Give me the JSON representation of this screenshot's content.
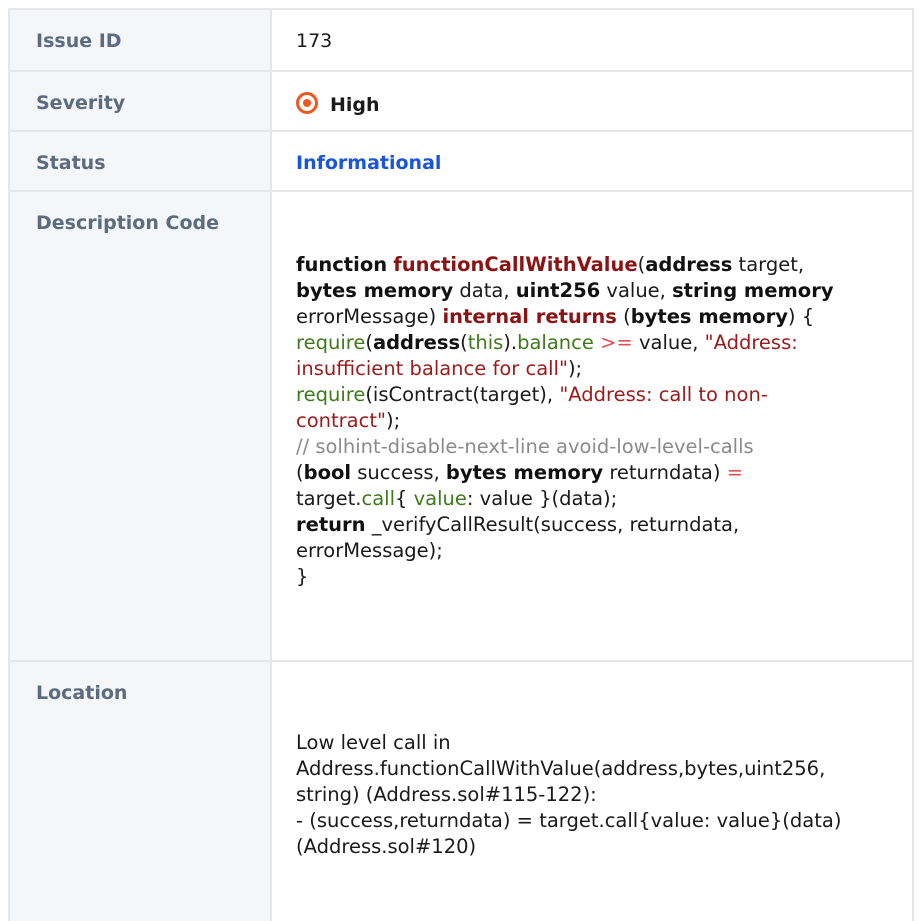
{
  "rows": {
    "issue_id": {
      "label": "Issue ID",
      "value": "173"
    },
    "severity": {
      "label": "Severity",
      "value": "High",
      "icon": "target-icon",
      "color": "#f0581e"
    },
    "status": {
      "label": "Status",
      "value": "Informational",
      "color": "#1a56db"
    },
    "description": {
      "label": "Description Code"
    },
    "location": {
      "label": "Location"
    }
  },
  "code": {
    "l1_kw_function": "function",
    "l1_fn_name": "functionCallWithValue",
    "l1_paren": "(",
    "l1_kw_address": "address",
    "l1_target": " target,",
    "l2_kw_bytes_memory": "bytes memory",
    "l2_data": " data, ",
    "l2_kw_uint256": "uint256",
    "l2_value": " value, ",
    "l2_kw_string_memory": "string memory",
    "l3_errormsg": "errorMessage) ",
    "l3_internal_returns": "internal returns",
    "l3_open": " (",
    "l3_kw_bytes_memory": "bytes memory",
    "l3_close": ") {",
    "l4_require": "require",
    "l4_paren": "(",
    "l4_kw_address": "address",
    "l4_paren2": "(",
    "l4_this": "this",
    "l4_dot": ").",
    "l4_balance": "balance",
    "l4_sp": " ",
    "l4_gte": ">=",
    "l4_value": " value, ",
    "l4_str1": "\"Address:",
    "l5_str2": "insufficient balance for call\"",
    "l5_end": ");",
    "l6_require": "require",
    "l6_mid": "(isContract(target), ",
    "l6_str1": "\"Address: call to non-",
    "l7_str2": "contract\"",
    "l7_end": ");",
    "l8_comment": "// solhint-disable-next-line avoid-low-level-calls",
    "l9_open": "(",
    "l9_kw_bool": "bool",
    "l9_success": " success, ",
    "l9_kw_bytes_memory": "bytes memory",
    "l9_returndata": " returndata) ",
    "l9_eq": "=",
    "l10_target": "target.",
    "l10_call": "call",
    "l10_brace": "{ ",
    "l10_value_kw": "value",
    "l10_rest": ": value }(data);",
    "l11_kw_return": "return",
    "l11_rest": " _verifyCallResult(success, returndata,",
    "l12": "errorMessage);",
    "l13": "}"
  },
  "location_text": {
    "l1": "Low level call in",
    "l2": "Address.functionCallWithValue(address,bytes,uint256,",
    "l3": "string) (Address.sol#115-122):",
    "l4": "- (success,returndata) = target.call{value: value}(data)",
    "l5": "(Address.sol#120)"
  }
}
